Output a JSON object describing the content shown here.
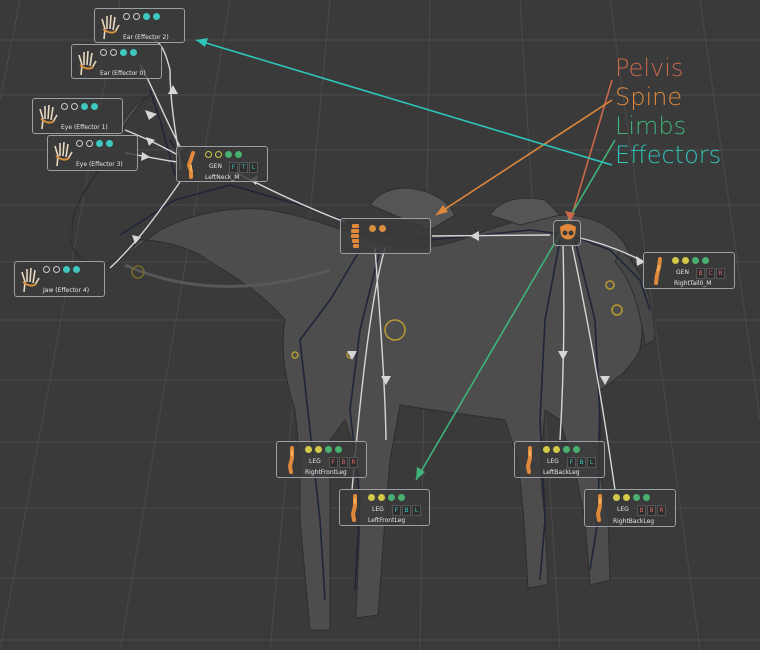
{
  "legend": {
    "pelvis": "Pelvis",
    "spine": "Spine",
    "limbs": "Limbs",
    "effectors": "Effectors"
  },
  "colors": {
    "pelvis": "#c8684a",
    "spine": "#e0893a",
    "limbs": "#3fb37a",
    "effectors": "#2fc4b8",
    "connection": "#d6d6d6",
    "node_border": "#9aa0a6"
  },
  "nodes": {
    "ear_effector2": {
      "label": "Ear (Effector 2)",
      "icon": "hand-icon"
    },
    "ear_effector0": {
      "label": "Ear (Effector 0)",
      "icon": "hand-icon"
    },
    "eye_effector1": {
      "label": "Eye (Effector 1)",
      "icon": "hand-icon"
    },
    "eye_effector3": {
      "label": "Eye (Effector 3)",
      "icon": "hand-icon"
    },
    "jaw_effector4": {
      "label": "Jaw (Effector 4)",
      "icon": "hand-icon"
    },
    "leftneck": {
      "label": "LeftNeck_M",
      "tag": "GEN",
      "chips": [
        "F",
        "T",
        "L"
      ]
    },
    "spine": {
      "label": "",
      "icon": "spine-icon"
    },
    "pelvis": {
      "label": "",
      "icon": "pelvis-icon"
    },
    "righttail": {
      "label": "RightTail0_M",
      "tag": "GEN",
      "chips": [
        "B",
        "C",
        "R"
      ]
    },
    "rightfrontleg": {
      "label": "RightFrontLeg",
      "tag": "LEG",
      "chips": [
        "F",
        "B",
        "R"
      ]
    },
    "leftfrontleg": {
      "label": "LeftFrontLeg",
      "tag": "LEG",
      "chips": [
        "F",
        "B",
        "L"
      ]
    },
    "leftbackleg": {
      "label": "LeftBackLeg",
      "tag": "LEG",
      "chips": [
        "F",
        "B",
        "L"
      ]
    },
    "rightbackleg": {
      "label": "RightBackLeg",
      "tag": "LEG",
      "chips": [
        "B",
        "B",
        "R"
      ]
    }
  }
}
